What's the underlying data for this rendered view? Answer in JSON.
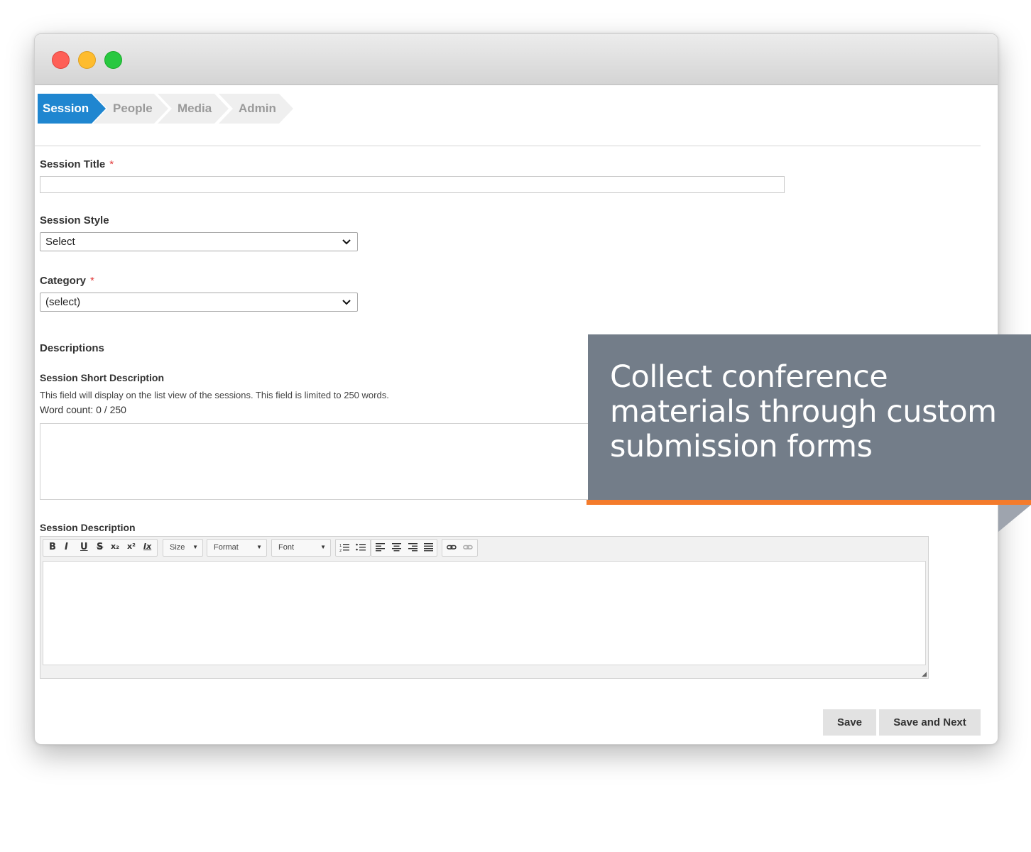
{
  "steps": [
    "Session",
    "People",
    "Media",
    "Admin"
  ],
  "form": {
    "title_label": "Session Title",
    "required_mark": "*",
    "style_label": "Session Style",
    "style_value": "Select",
    "category_label": "Category",
    "category_value": "(select)",
    "descriptions_heading": "Descriptions",
    "short_desc_label": "Session Short Description",
    "short_desc_help": "This field will display on the list view of the sessions. This field is limited to 250 words.",
    "word_count": "Word count: 0 / 250",
    "desc_label": "Session Description"
  },
  "toolbar": {
    "bold": "B",
    "italic": "I",
    "underline": "U",
    "strike": "S",
    "subscript": "x₂",
    "superscript": "x²",
    "clear_format": "Ix",
    "size": "Size",
    "format": "Format",
    "font": "Font"
  },
  "buttons": {
    "save": "Save",
    "save_next": "Save and Next"
  },
  "callout": {
    "text": "Collect conference materials through custom submission forms"
  },
  "colors": {
    "active_step": "#1f86d0",
    "callout_bg": "#737d89",
    "accent": "#f47b2b",
    "required": "#e23b3b"
  }
}
